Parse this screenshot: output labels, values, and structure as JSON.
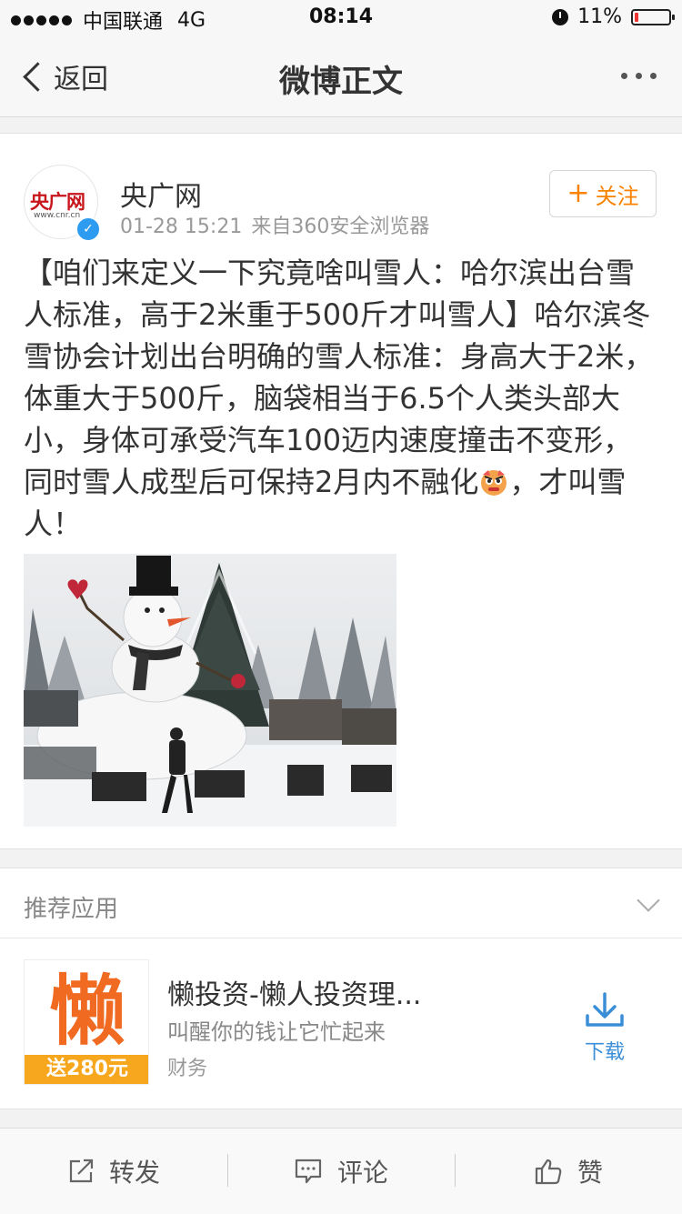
{
  "status_bar": {
    "carrier": "中国联通",
    "network": "4G",
    "time": "08:14",
    "battery": "11%",
    "battery_level": 0.11
  },
  "nav": {
    "back_label": "返回",
    "title": "微博正文"
  },
  "post": {
    "author": "央广网",
    "avatar_logo": "央广网",
    "avatar_sub": "www.cnr.cn",
    "time": "01-28 15:21",
    "source": "来自360安全浏览器",
    "follow_label": "关注",
    "text_part1": "【咱们来定义一下究竟啥叫雪人：哈尔滨出台雪人标准，高于2米重于500斤才叫雪人】哈尔滨冬雪协会计划出台明确的雪人标准：身高大于2米，体重大于500斤，脑袋相当于6.5个人类头部大小，身体可承受汽车100迈内速度撞击不变形，同时雪人成型后可保持2月内不融化",
    "text_part2": "，才叫雪人！",
    "emoji": "angry-face",
    "image": "snowman-photo"
  },
  "recommend": {
    "title": "推荐应用",
    "app": {
      "icon_glyph": "懒",
      "badge": "送280元",
      "name": "懒投资-懒人投资理...",
      "description": "叫醒你的钱让它忙起来",
      "category": "财务",
      "download_label": "下载"
    }
  },
  "bottom_bar": {
    "repost": "转发",
    "comment": "评论",
    "like": "赞"
  },
  "colors": {
    "follow_orange": "#f98200",
    "verified_blue": "#2d9bf0",
    "download_blue": "#3a8ed8",
    "app_orange": "#f06a22",
    "badge_yellow": "#f7a71d"
  }
}
